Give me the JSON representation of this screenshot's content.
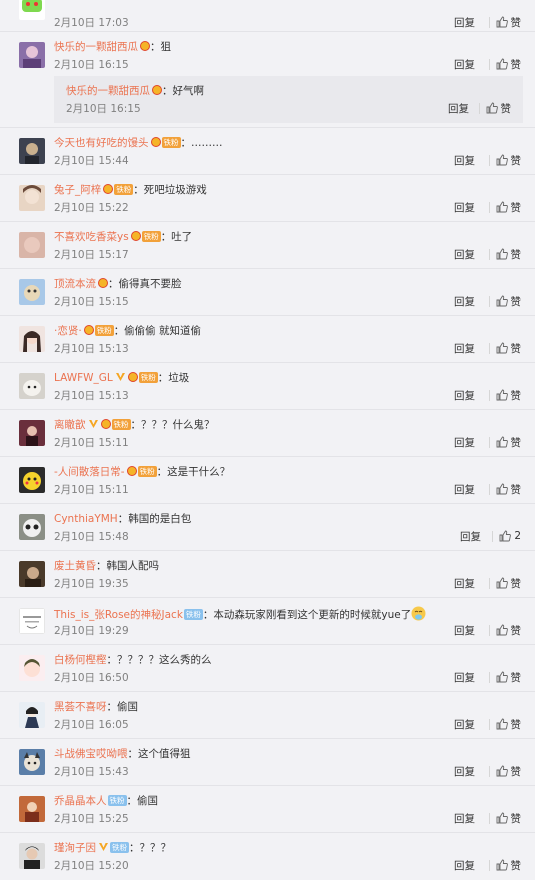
{
  "actions": {
    "reply": "回复",
    "like": "赞"
  },
  "badges": {
    "fan": "铁粉"
  },
  "comments": [
    {
      "user": "",
      "text": "",
      "time": "2月10日 17:03",
      "likes": ""
    },
    {
      "user": "快乐的一颗甜西瓜",
      "text": "：狙",
      "time": "2月10日 16:15",
      "likes": "",
      "sub": {
        "user": "快乐的一颗甜西瓜",
        "text": "：好气啊",
        "time": "2月10日 16:15"
      }
    },
    {
      "user": "今天也有好吃的馒头",
      "text": "：………",
      "time": "2月10日 15:44",
      "likes": ""
    },
    {
      "user": "兔子_阿梓",
      "text": "：死吧垃圾游戏",
      "time": "2月10日 15:22",
      "likes": ""
    },
    {
      "user": "不喜欢吃香菜ys",
      "text": "：吐了",
      "time": "2月10日 15:17",
      "likes": ""
    },
    {
      "user": "顶流本流",
      "text": "：偷得真不要脸",
      "time": "2月10日 15:15",
      "likes": ""
    },
    {
      "user": "·恋贤·",
      "text": "：偷偷偷 就知道偷",
      "time": "2月10日 15:13",
      "likes": ""
    },
    {
      "user": "LAWFW_GL",
      "text": "：垃圾",
      "time": "2月10日 15:13",
      "likes": ""
    },
    {
      "user": "离瞮歆",
      "text": "：？？？什么鬼？",
      "time": "2月10日 15:11",
      "likes": ""
    },
    {
      "user": "-人间散落日常-",
      "text": "：这是干什么？",
      "time": "2月10日 15:11",
      "likes": ""
    },
    {
      "user": "CynthiaYMH",
      "text": "：韩国的是白包",
      "time": "2月10日 15:48",
      "likes": "2"
    },
    {
      "user": "废土黄昏",
      "text": "：韩国人配吗",
      "time": "2月10日 19:35",
      "likes": ""
    },
    {
      "user": "This_is_张Rose的神秘Jack",
      "text": "：本动森玩家刚看到这个更新的时候就yue了",
      "time": "2月10日 19:29",
      "likes": ""
    },
    {
      "user": "白杨何樫樫",
      "text": "：？？？？这么秀的么",
      "time": "2月10日 16:50",
      "likes": ""
    },
    {
      "user": "黑荟不喜呀",
      "text": "：偷国",
      "time": "2月10日 16:05",
      "likes": ""
    },
    {
      "user": "斗战佛宝哎呦喂",
      "text": "：这个值得狙",
      "time": "2月10日 15:43",
      "likes": ""
    },
    {
      "user": "乔晶晶本人",
      "text": "：偷国",
      "time": "2月10日 15:25",
      "likes": ""
    },
    {
      "user": "瑾洵子因",
      "text": "：？？？",
      "time": "2月10日 15:20",
      "likes": ""
    }
  ]
}
